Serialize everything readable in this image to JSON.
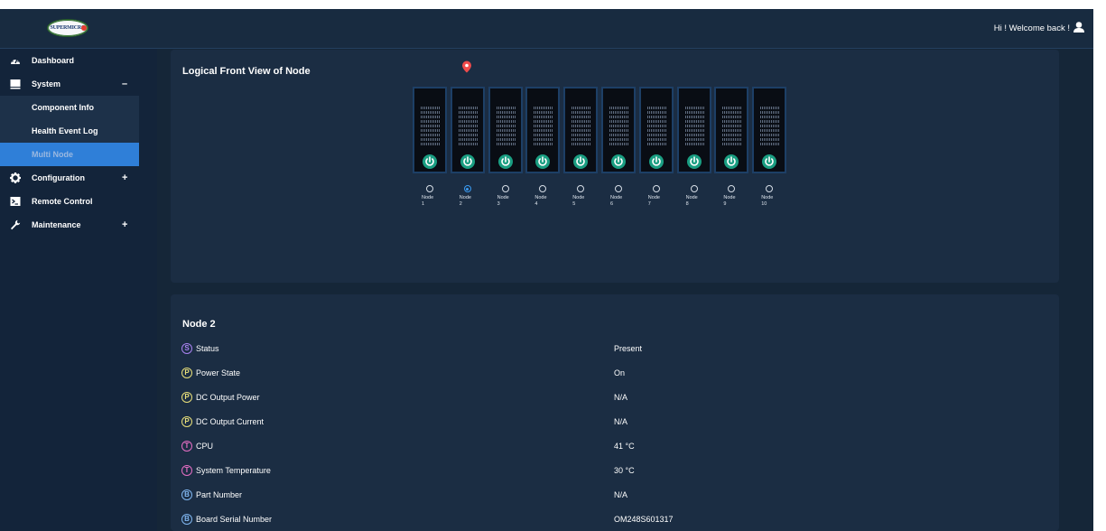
{
  "header": {
    "logo_text": "SUPERMICRO",
    "welcome": "Hi ! Welcome back !"
  },
  "sidebar": {
    "items": [
      {
        "label": "Dashboard",
        "icon": "dashboard-icon"
      },
      {
        "label": "System",
        "icon": "monitor-icon",
        "toggle": "–"
      },
      {
        "label": "Component Info"
      },
      {
        "label": "Health Event Log"
      },
      {
        "label": "Multi Node",
        "active": true
      },
      {
        "label": "Configuration",
        "icon": "gear-icon",
        "toggle": "+"
      },
      {
        "label": "Remote Control",
        "icon": "terminal-icon"
      },
      {
        "label": "Maintenance",
        "icon": "wrench-icon",
        "toggle": "+"
      }
    ]
  },
  "front_view": {
    "title": "Logical Front View of Node",
    "selected_node": 2,
    "nodes": [
      {
        "label": "Node",
        "num": "1"
      },
      {
        "label": "Node",
        "num": "2"
      },
      {
        "label": "Node",
        "num": "3"
      },
      {
        "label": "Node",
        "num": "4"
      },
      {
        "label": "Node",
        "num": "5"
      },
      {
        "label": "Node",
        "num": "6"
      },
      {
        "label": "Node",
        "num": "7"
      },
      {
        "label": "Node",
        "num": "8"
      },
      {
        "label": "Node",
        "num": "9"
      },
      {
        "label": "Node",
        "num": "10"
      }
    ]
  },
  "details": {
    "title": "Node 2",
    "rows": [
      {
        "badge": "S",
        "color": "#a882f0",
        "label": "Status",
        "value": "Present"
      },
      {
        "badge": "P",
        "color": "#e8df7a",
        "label": "Power State",
        "value": "On"
      },
      {
        "badge": "P",
        "color": "#e8df7a",
        "label": "DC Output Power",
        "value": "N/A"
      },
      {
        "badge": "P",
        "color": "#e8df7a",
        "label": "DC Output Current",
        "value": "N/A"
      },
      {
        "badge": "T",
        "color": "#e46ec4",
        "label": "CPU",
        "value": "41 °C"
      },
      {
        "badge": "T",
        "color": "#e46ec4",
        "label": "System Temperature",
        "value": "30 °C"
      },
      {
        "badge": "B",
        "color": "#7fb6f0",
        "label": "Part Number",
        "value": "N/A"
      },
      {
        "badge": "B",
        "color": "#7fb6f0",
        "label": "Board Serial Number",
        "value": "OM248S601317"
      }
    ]
  },
  "colors": {
    "background": "#152638",
    "card": "#1b2d43",
    "accent": "#2f7fd8",
    "power_green": "#1a9e82",
    "right_tab_green": "#3dbf8f",
    "right_tab_red": "#e46c6c"
  },
  "right_tabs": [
    "power-tab-icon",
    "refresh-tab-icon",
    "info-tab-icon",
    "globe-tab-icon"
  ]
}
